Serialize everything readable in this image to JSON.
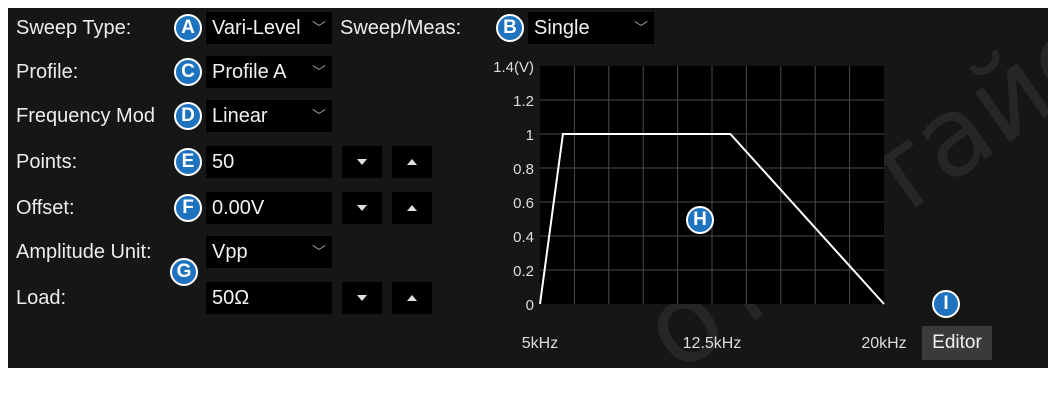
{
  "labels": {
    "sweep_type": "Sweep Type:",
    "sweep_meas": "Sweep/Meas:",
    "profile": "Profile:",
    "frequency_mode": "Frequency Mod",
    "points": "Points:",
    "offset": "Offset:",
    "amplitude_unit": "Amplitude Unit:",
    "load": "Load:"
  },
  "values": {
    "sweep_type": "Vari-Level",
    "sweep_meas": "Single",
    "profile": "Profile A",
    "frequency_mode": "Linear",
    "points": "50",
    "offset": "0.00V",
    "amplitude_unit": "Vpp",
    "load": "50Ω"
  },
  "badges": [
    "A",
    "B",
    "C",
    "D",
    "E",
    "F",
    "G",
    "H",
    "I"
  ],
  "editor_button": "Editor",
  "watermark": "ответайс",
  "colors": {
    "panel_bg": "#161616",
    "field_bg": "#000000",
    "badge": "#1e73be",
    "trace": "#ffffff"
  },
  "chart_data": {
    "type": "line",
    "ylabel": "(V)",
    "yticks": [
      "1.4(V)",
      "1.2",
      "1",
      "0.8",
      "0.6",
      "0.4",
      "0.2",
      "0"
    ],
    "xticks": [
      "5kHz",
      "12.5kHz",
      "20kHz"
    ],
    "xlim": [
      5,
      20
    ],
    "ylim": [
      0,
      1.4
    ],
    "grid": true,
    "series": [
      {
        "x": [
          5,
          6.0,
          10.2,
          12.5,
          13.3,
          20
        ],
        "y": [
          0,
          1,
          1,
          1,
          1,
          0
        ]
      }
    ]
  }
}
